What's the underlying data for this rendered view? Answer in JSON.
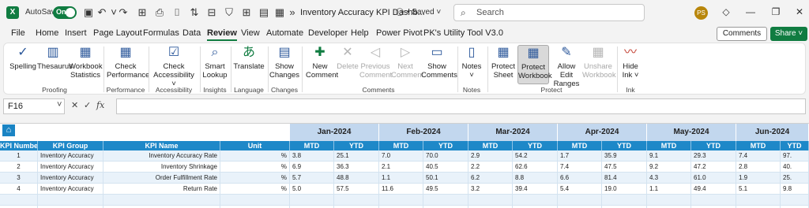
{
  "titlebar": {
    "logo": "X",
    "autosave_label": "AutoSave",
    "autosave_state": "On",
    "doc_title": "Inventory Accuracy KPI Dashb...",
    "saved_status": "• Saved ˅",
    "search_placeholder": "Search",
    "avatar_initials": "PS"
  },
  "tabs": [
    "File",
    "Home",
    "Insert",
    "Page Layout",
    "Formulas",
    "Data",
    "Review",
    "View",
    "Automate",
    "Developer",
    "Help",
    "Power Pivot",
    "PK's Utility Tool V3.0"
  ],
  "active_tab": "Review",
  "header_buttons": {
    "comments": "Comments",
    "share": "Share ˅"
  },
  "ribbon": {
    "buttons": {
      "spelling": "Spelling",
      "thesaurus": "Thesaurus",
      "workbook_statistics": "Workbook Statistics",
      "check_performance": "Check Performance",
      "check_accessibility": "Check Accessibility ˅",
      "smart_lookup": "Smart Lookup",
      "translate": "Translate",
      "show_changes": "Show Changes",
      "new_comment": "New Comment",
      "delete": "Delete",
      "previous_comment": "Previous Comment",
      "next_comment": "Next Comment",
      "show_comments": "Show Comments",
      "notes": "Notes ˅",
      "protect_sheet": "Protect Sheet",
      "protect_workbook": "Protect Workbook",
      "allow_edit_ranges": "Allow Edit Ranges",
      "unshare_workbook": "Unshare Workbook",
      "hide_ink": "Hide Ink ˅"
    },
    "groups": {
      "proofing": "Proofing",
      "performance": "Performance",
      "accessibility": "Accessibility",
      "insights": "Insights",
      "language": "Language",
      "changes": "Changes",
      "comments": "Comments",
      "notes": "Notes",
      "protect": "Protect",
      "ink": "Ink"
    }
  },
  "formula_bar": {
    "cell_ref": "F16",
    "value": ""
  },
  "table": {
    "months": [
      "Jan-2024",
      "Feb-2024",
      "Mar-2024",
      "Apr-2024",
      "May-2024",
      "Jun-2024"
    ],
    "headers": [
      "KPI Number",
      "KPI Group",
      "KPI Name",
      "Unit"
    ],
    "sub_headers": [
      "MTD",
      "YTD"
    ],
    "rows": [
      {
        "num": "1",
        "group": "Inventory Accuracy",
        "name": "Inventory Accuracy Rate",
        "unit": "%",
        "vals": [
          "3.8",
          "25.1",
          "7.0",
          "70.0",
          "2.9",
          "54.2",
          "1.7",
          "35.9",
          "9.1",
          "29.3",
          "7.4",
          "97."
        ]
      },
      {
        "num": "2",
        "group": "Inventory Accuracy",
        "name": "Inventory Shrinkage",
        "unit": "%",
        "vals": [
          "6.9",
          "36.3",
          "2.1",
          "40.5",
          "2.2",
          "62.6",
          "7.4",
          "47.5",
          "9.2",
          "47.2",
          "2.8",
          "40."
        ]
      },
      {
        "num": "3",
        "group": "Inventory Accuracy",
        "name": "Order Fulfillment Rate",
        "unit": "%",
        "vals": [
          "5.7",
          "48.8",
          "1.1",
          "50.1",
          "6.2",
          "8.8",
          "6.6",
          "81.4",
          "4.3",
          "61.0",
          "1.9",
          "25."
        ]
      },
      {
        "num": "4",
        "group": "Inventory Accuracy",
        "name": "Return Rate",
        "unit": "%",
        "vals": [
          "5.0",
          "57.5",
          "11.6",
          "49.5",
          "3.2",
          "39.4",
          "5.4",
          "19.0",
          "1.1",
          "49.4",
          "5.1",
          "9.8"
        ]
      }
    ]
  },
  "colors": {
    "accent": "#107c41",
    "header_blue": "#1e88c8",
    "month_band": "#c2d7ee",
    "row_alt": "#e9f2fa"
  }
}
